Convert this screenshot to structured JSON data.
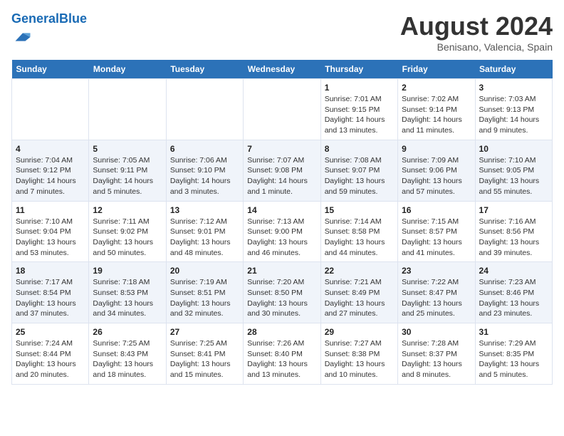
{
  "header": {
    "logo_general": "General",
    "logo_blue": "Blue",
    "month_year": "August 2024",
    "location": "Benisano, Valencia, Spain"
  },
  "weekdays": [
    "Sunday",
    "Monday",
    "Tuesday",
    "Wednesday",
    "Thursday",
    "Friday",
    "Saturday"
  ],
  "rows": [
    [
      {
        "day": "",
        "detail": ""
      },
      {
        "day": "",
        "detail": ""
      },
      {
        "day": "",
        "detail": ""
      },
      {
        "day": "",
        "detail": ""
      },
      {
        "day": "1",
        "detail": "Sunrise: 7:01 AM\nSunset: 9:15 PM\nDaylight: 14 hours\nand 13 minutes."
      },
      {
        "day": "2",
        "detail": "Sunrise: 7:02 AM\nSunset: 9:14 PM\nDaylight: 14 hours\nand 11 minutes."
      },
      {
        "day": "3",
        "detail": "Sunrise: 7:03 AM\nSunset: 9:13 PM\nDaylight: 14 hours\nand 9 minutes."
      }
    ],
    [
      {
        "day": "4",
        "detail": "Sunrise: 7:04 AM\nSunset: 9:12 PM\nDaylight: 14 hours\nand 7 minutes."
      },
      {
        "day": "5",
        "detail": "Sunrise: 7:05 AM\nSunset: 9:11 PM\nDaylight: 14 hours\nand 5 minutes."
      },
      {
        "day": "6",
        "detail": "Sunrise: 7:06 AM\nSunset: 9:10 PM\nDaylight: 14 hours\nand 3 minutes."
      },
      {
        "day": "7",
        "detail": "Sunrise: 7:07 AM\nSunset: 9:08 PM\nDaylight: 14 hours\nand 1 minute."
      },
      {
        "day": "8",
        "detail": "Sunrise: 7:08 AM\nSunset: 9:07 PM\nDaylight: 13 hours\nand 59 minutes."
      },
      {
        "day": "9",
        "detail": "Sunrise: 7:09 AM\nSunset: 9:06 PM\nDaylight: 13 hours\nand 57 minutes."
      },
      {
        "day": "10",
        "detail": "Sunrise: 7:10 AM\nSunset: 9:05 PM\nDaylight: 13 hours\nand 55 minutes."
      }
    ],
    [
      {
        "day": "11",
        "detail": "Sunrise: 7:10 AM\nSunset: 9:04 PM\nDaylight: 13 hours\nand 53 minutes."
      },
      {
        "day": "12",
        "detail": "Sunrise: 7:11 AM\nSunset: 9:02 PM\nDaylight: 13 hours\nand 50 minutes."
      },
      {
        "day": "13",
        "detail": "Sunrise: 7:12 AM\nSunset: 9:01 PM\nDaylight: 13 hours\nand 48 minutes."
      },
      {
        "day": "14",
        "detail": "Sunrise: 7:13 AM\nSunset: 9:00 PM\nDaylight: 13 hours\nand 46 minutes."
      },
      {
        "day": "15",
        "detail": "Sunrise: 7:14 AM\nSunset: 8:58 PM\nDaylight: 13 hours\nand 44 minutes."
      },
      {
        "day": "16",
        "detail": "Sunrise: 7:15 AM\nSunset: 8:57 PM\nDaylight: 13 hours\nand 41 minutes."
      },
      {
        "day": "17",
        "detail": "Sunrise: 7:16 AM\nSunset: 8:56 PM\nDaylight: 13 hours\nand 39 minutes."
      }
    ],
    [
      {
        "day": "18",
        "detail": "Sunrise: 7:17 AM\nSunset: 8:54 PM\nDaylight: 13 hours\nand 37 minutes."
      },
      {
        "day": "19",
        "detail": "Sunrise: 7:18 AM\nSunset: 8:53 PM\nDaylight: 13 hours\nand 34 minutes."
      },
      {
        "day": "20",
        "detail": "Sunrise: 7:19 AM\nSunset: 8:51 PM\nDaylight: 13 hours\nand 32 minutes."
      },
      {
        "day": "21",
        "detail": "Sunrise: 7:20 AM\nSunset: 8:50 PM\nDaylight: 13 hours\nand 30 minutes."
      },
      {
        "day": "22",
        "detail": "Sunrise: 7:21 AM\nSunset: 8:49 PM\nDaylight: 13 hours\nand 27 minutes."
      },
      {
        "day": "23",
        "detail": "Sunrise: 7:22 AM\nSunset: 8:47 PM\nDaylight: 13 hours\nand 25 minutes."
      },
      {
        "day": "24",
        "detail": "Sunrise: 7:23 AM\nSunset: 8:46 PM\nDaylight: 13 hours\nand 23 minutes."
      }
    ],
    [
      {
        "day": "25",
        "detail": "Sunrise: 7:24 AM\nSunset: 8:44 PM\nDaylight: 13 hours\nand 20 minutes."
      },
      {
        "day": "26",
        "detail": "Sunrise: 7:25 AM\nSunset: 8:43 PM\nDaylight: 13 hours\nand 18 minutes."
      },
      {
        "day": "27",
        "detail": "Sunrise: 7:25 AM\nSunset: 8:41 PM\nDaylight: 13 hours\nand 15 minutes."
      },
      {
        "day": "28",
        "detail": "Sunrise: 7:26 AM\nSunset: 8:40 PM\nDaylight: 13 hours\nand 13 minutes."
      },
      {
        "day": "29",
        "detail": "Sunrise: 7:27 AM\nSunset: 8:38 PM\nDaylight: 13 hours\nand 10 minutes."
      },
      {
        "day": "30",
        "detail": "Sunrise: 7:28 AM\nSunset: 8:37 PM\nDaylight: 13 hours\nand 8 minutes."
      },
      {
        "day": "31",
        "detail": "Sunrise: 7:29 AM\nSunset: 8:35 PM\nDaylight: 13 hours\nand 5 minutes."
      }
    ]
  ]
}
